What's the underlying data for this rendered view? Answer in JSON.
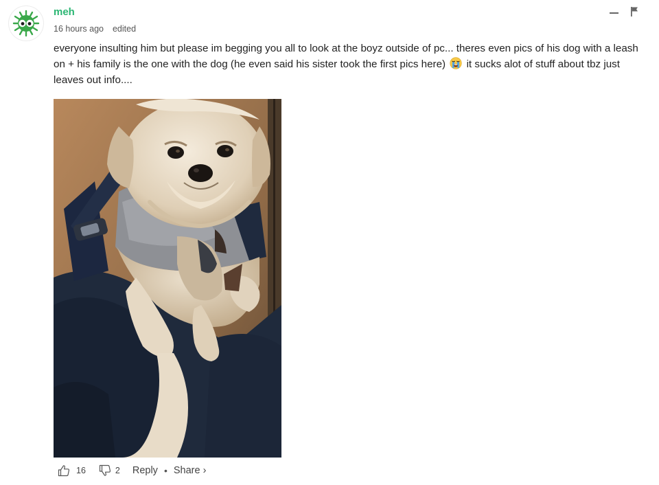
{
  "comment": {
    "author": "meh",
    "timestamp": "16 hours ago",
    "edited_label": "edited",
    "avatar_icon": "green-splat-eyes-icon",
    "brand_color": "#2bb673",
    "body_before_emoji": "everyone insulting him but please im begging you all to look at the boyz outside of pc... theres even pics of his dog with a leash on + his family is the one with the dog (he even said his sister took the first pics here)",
    "emoji_icon": "loudly-crying-face-emoji",
    "body_after_emoji": "it sucks alot of stuff about tbz just leaves out info....",
    "attached_image": "photo of a small fluffy cream-colored dog in a gray hoodie and dark harness held in arms",
    "upvotes": "16",
    "downvotes": "2",
    "reply_label": "Reply",
    "separator": "•",
    "share_label": "Share ›",
    "icons": {
      "collapse": "collapse-minus-icon",
      "flag": "flag-icon",
      "upvote": "thumbs-up-icon",
      "downvote": "thumbs-down-icon"
    }
  }
}
